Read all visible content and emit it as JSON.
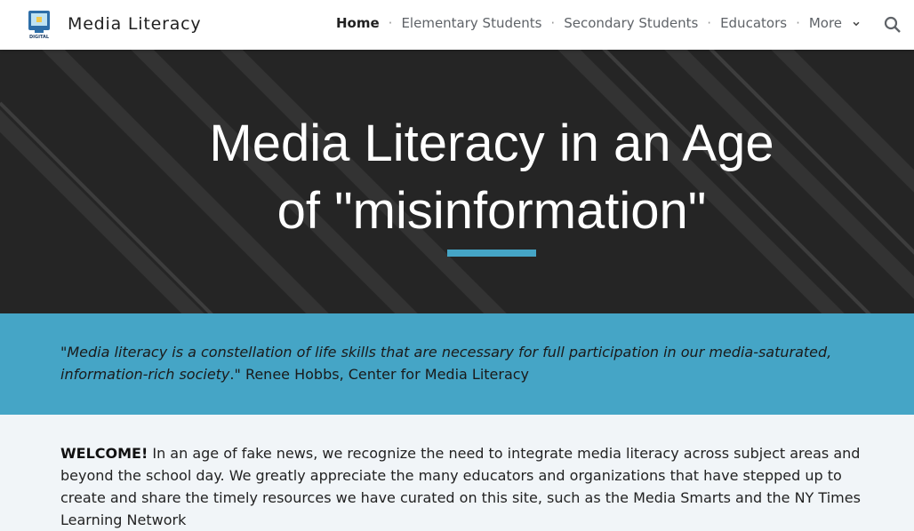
{
  "header": {
    "site_title": "Media Literacy",
    "logo_text": "DIGITAL",
    "nav": [
      {
        "label": "Home",
        "active": true
      },
      {
        "label": "Elementary Students",
        "active": false
      },
      {
        "label": "Secondary Students",
        "active": false
      },
      {
        "label": "Educators",
        "active": false
      },
      {
        "label": "More",
        "active": false
      }
    ],
    "separator": "·",
    "search_icon": "search-icon"
  },
  "hero": {
    "title_line1": "Media Literacy in an Age",
    "title_line2": "of \"misinformation\"",
    "accent_color": "#45a5c6"
  },
  "quote": {
    "italic_text": "\"Media literacy is a constellation of life skills that are necessary for full participation in our media-saturated, information-rich society",
    "attribution": ".\" Renee Hobbs, Center for Media Literacy"
  },
  "welcome": {
    "lead": "WELCOME!",
    "text": " In an age of fake news, we recognize the need to integrate media literacy across subject areas and beyond the school day. We greatly appreciate the many educators and organizations that have stepped up to create and share the timely resources we have curated on this site, such as the Media Smarts and the NY Times Learning Network"
  },
  "colors": {
    "band": "#45a5c6",
    "content_bg": "#f1f5f8"
  }
}
